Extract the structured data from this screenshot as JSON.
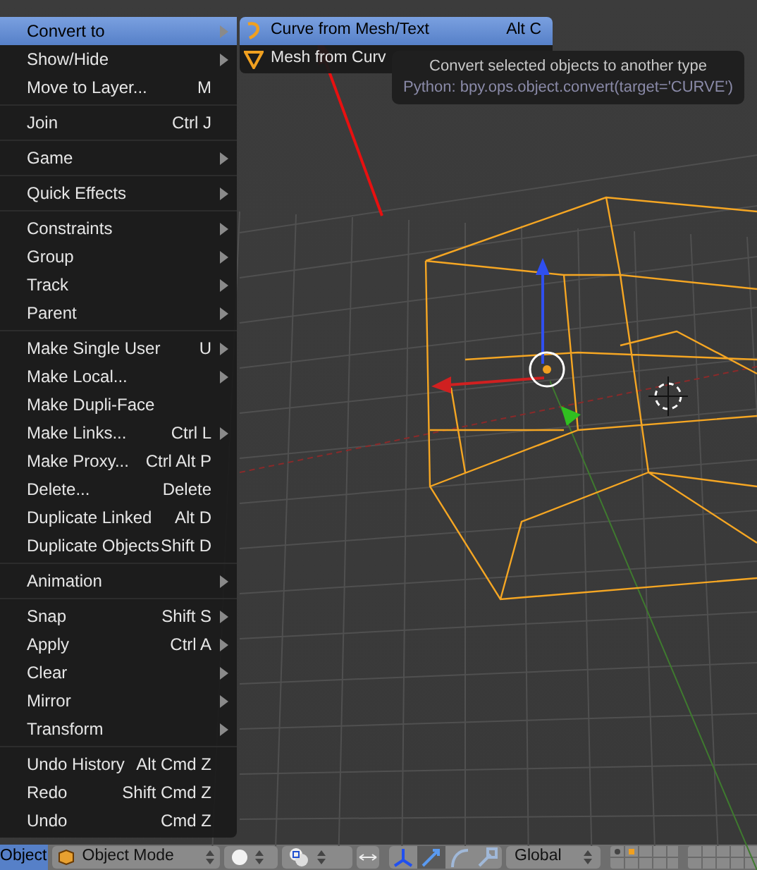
{
  "menu": {
    "sections": [
      [
        {
          "label": "Convert to",
          "submenu": true,
          "selected": true
        },
        {
          "label": "Show/Hide",
          "submenu": true,
          "selected": false
        },
        {
          "label": "Move to Layer...",
          "shortcut": "M",
          "submenu": false,
          "selected": false
        }
      ],
      [
        {
          "label": "Join",
          "shortcut": "Ctrl J",
          "submenu": false,
          "selected": false
        }
      ],
      [
        {
          "label": "Game",
          "submenu": true,
          "selected": false
        }
      ],
      [
        {
          "label": "Quick Effects",
          "submenu": true,
          "selected": false
        }
      ],
      [
        {
          "label": "Constraints",
          "submenu": true,
          "selected": false
        },
        {
          "label": "Group",
          "submenu": true,
          "selected": false
        },
        {
          "label": "Track",
          "submenu": true,
          "selected": false
        },
        {
          "label": "Parent",
          "submenu": true,
          "selected": false
        }
      ],
      [
        {
          "label": "Make Single User",
          "shortcut": "U",
          "submenu": true,
          "selected": false
        },
        {
          "label": "Make Local...",
          "submenu": true,
          "selected": false
        },
        {
          "label": "Make Dupli-Face",
          "submenu": false,
          "selected": false
        },
        {
          "label": "Make Links...",
          "shortcut": "Ctrl L",
          "submenu": true,
          "selected": false
        },
        {
          "label": "Make Proxy...",
          "shortcut": "Ctrl Alt P",
          "submenu": false,
          "selected": false
        },
        {
          "label": "Delete...",
          "shortcut": "Delete",
          "submenu": false,
          "selected": false
        },
        {
          "label": "Duplicate Linked",
          "shortcut": "Alt D",
          "submenu": false,
          "selected": false
        },
        {
          "label": "Duplicate Objects",
          "shortcut": "Shift D",
          "submenu": false,
          "selected": false
        }
      ],
      [
        {
          "label": "Animation",
          "submenu": true,
          "selected": false
        }
      ],
      [
        {
          "label": "Snap",
          "shortcut": "Shift S",
          "submenu": true,
          "selected": false
        },
        {
          "label": "Apply",
          "shortcut": "Ctrl A",
          "submenu": true,
          "selected": false
        },
        {
          "label": "Clear",
          "submenu": true,
          "selected": false
        },
        {
          "label": "Mirror",
          "submenu": true,
          "selected": false
        },
        {
          "label": "Transform",
          "submenu": true,
          "selected": false
        }
      ],
      [
        {
          "label": "Undo History",
          "shortcut": "Alt Cmd Z",
          "submenu": false,
          "selected": false
        },
        {
          "label": "Redo",
          "shortcut": "Shift Cmd Z",
          "submenu": false,
          "selected": false
        },
        {
          "label": "Undo",
          "shortcut": "Cmd Z",
          "submenu": false,
          "selected": false
        }
      ]
    ]
  },
  "submenu": {
    "items": [
      {
        "kind": "curve",
        "label": "Curve from Mesh/Text",
        "shortcut": "Alt C",
        "selected": true
      },
      {
        "kind": "mesh",
        "label": "Mesh from Curv",
        "selected": false
      }
    ]
  },
  "tooltip": {
    "description": "Convert selected objects to another type",
    "python": "Python: bpy.ops.object.convert(target='CURVE')"
  },
  "header": {
    "menu_button": "Object",
    "mode": "Object Mode",
    "orientation": "Global"
  }
}
